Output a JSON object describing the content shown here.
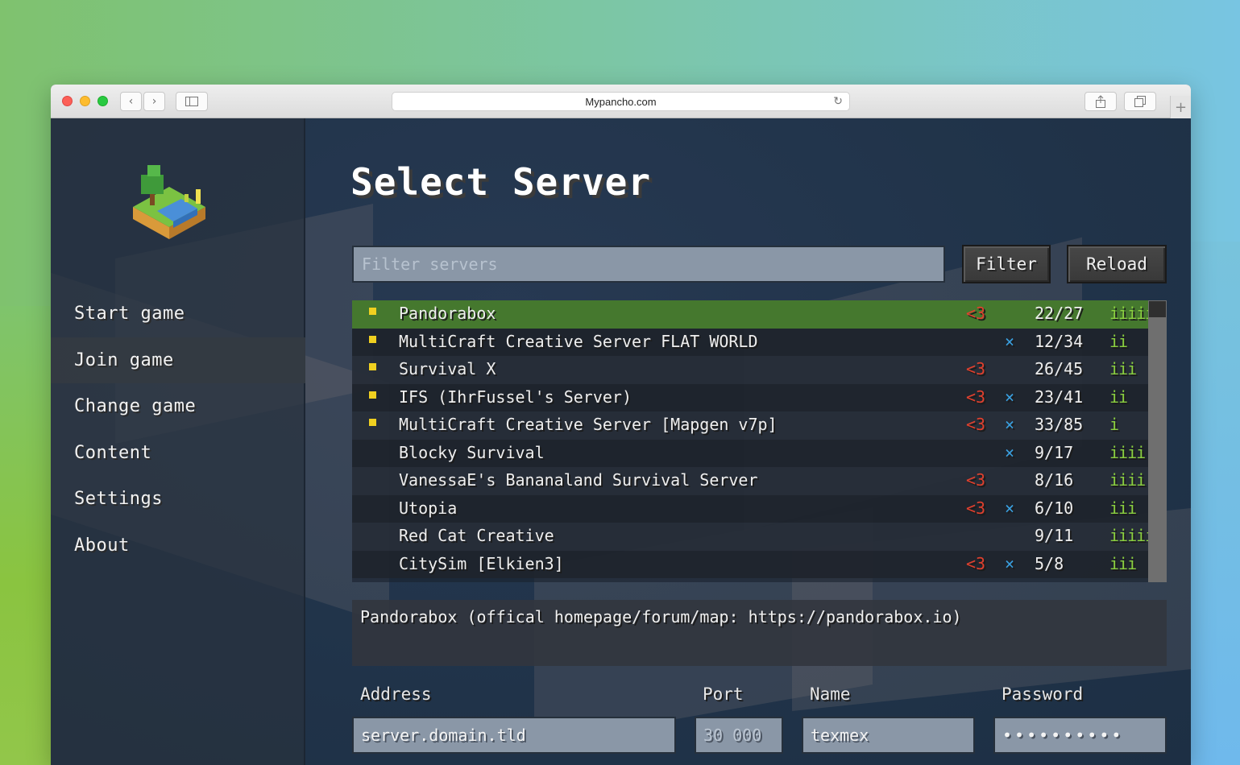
{
  "browser": {
    "url": "Mypancho.com",
    "back_icon": "chevron-left-icon",
    "forward_icon": "chevron-right-icon",
    "reload_icon": "reload-icon"
  },
  "sidebar": {
    "items": [
      {
        "label": "Start game",
        "active": false
      },
      {
        "label": "Join game",
        "active": true
      },
      {
        "label": "Change game",
        "active": false
      },
      {
        "label": "Content",
        "active": false
      },
      {
        "label": "Settings",
        "active": false
      },
      {
        "label": "About",
        "active": false
      }
    ]
  },
  "main": {
    "title": "Select Server",
    "filter_placeholder": "Filter servers",
    "filter_button": "Filter",
    "reload_button": "Reload"
  },
  "servers": {
    "selected_index": 0,
    "rows": [
      {
        "bullet": true,
        "name": "Pandorabox",
        "fav": "<3",
        "x": "",
        "players": "22/27",
        "ping": "iiiii"
      },
      {
        "bullet": true,
        "name": "MultiCraft Creative Server FLAT WORLD",
        "fav": "",
        "x": "×",
        "players": "12/34",
        "ping": "ii"
      },
      {
        "bullet": true,
        "name": "Survival X",
        "fav": "<3",
        "x": "",
        "players": "26/45",
        "ping": "iii"
      },
      {
        "bullet": true,
        "name": "IFS (IhrFussel's Server)",
        "fav": "<3",
        "x": "×",
        "players": "23/41",
        "ping": "ii"
      },
      {
        "bullet": true,
        "name": "MultiCraft Creative Server [Mapgen v7p]",
        "fav": "<3",
        "x": "×",
        "players": "33/85",
        "ping": "i"
      },
      {
        "bullet": false,
        "name": "Blocky Survival",
        "fav": "",
        "x": "×",
        "players": "9/17",
        "ping": "iiii"
      },
      {
        "bullet": false,
        "name": "VanessaE's Bananaland Survival Server",
        "fav": "<3",
        "x": "",
        "players": "8/16",
        "ping": "iiii"
      },
      {
        "bullet": false,
        "name": "Utopia",
        "fav": "<3",
        "x": "×",
        "players": "6/10",
        "ping": "iii"
      },
      {
        "bullet": false,
        "name": "Red Cat Creative",
        "fav": "",
        "x": "",
        "players": "9/11",
        "ping": "iiiii"
      },
      {
        "bullet": false,
        "name": "CitySim [Elkien3]",
        "fav": "<3",
        "x": "×",
        "players": "5/8",
        "ping": "iii"
      }
    ]
  },
  "description": "Pandorabox (offical homepage/forum/map: https://pandorabox.io)",
  "form": {
    "address_label": "Address",
    "address_value": "server.domain.tld",
    "port_label": "Port",
    "port_placeholder": "30 000",
    "name_label": "Name",
    "name_value": "texmex",
    "password_label": "Password",
    "password_value": "••••••••••"
  },
  "colors": {
    "selected_row": "#45782e",
    "favorite": "#e0402e",
    "compat_x": "#3aa0e0",
    "ping": "#8bd040",
    "bullet": "#f0d020"
  }
}
